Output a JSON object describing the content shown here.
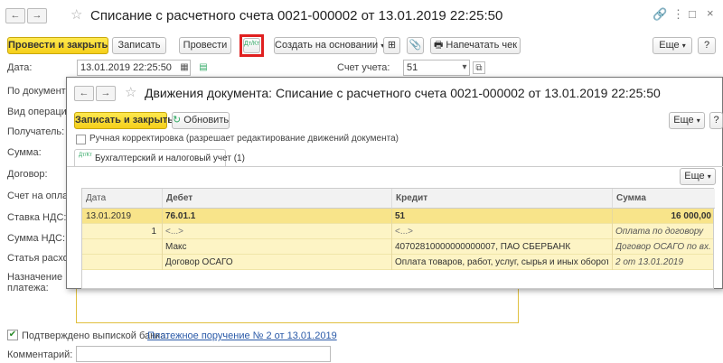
{
  "doc": {
    "title": "Списание с расчетного счета 0021-000002 от 13.01.2019 22:25:50",
    "nav_back": "←",
    "nav_forward": "→",
    "toolbar": {
      "post_close": "Провести и закрыть",
      "save": "Записать",
      "post": "Провести",
      "dtkt_icon": "Дт/Кт",
      "create_based": "Создать на основании",
      "print_check": "Напечатать чек",
      "more": "Еще",
      "help": "?"
    },
    "labels": {
      "date": "Дата:",
      "by_document": "По документу №",
      "operation": "Вид операции:",
      "recipient": "Получатель:",
      "sum": "Сумма:",
      "contract": "Договор:",
      "pay_account": "Счет на оплату",
      "vat_rate": "Ставка НДС:",
      "vat_sum": "Сумма НДС:",
      "expense_item": "Статья расходов",
      "purpose_1": "Назначение",
      "purpose_2": "платежа:",
      "account": "Счет учета:",
      "confirmed": "Подтверждено выпиской банка:",
      "comment": "Комментарий:"
    },
    "date_value": "13.01.2019 22:25:50",
    "account_value": "51",
    "payment_link": "Платежное поручение № 2 от 13.01.2019",
    "comment_value": ""
  },
  "movements": {
    "title": "Движения документа: Списание с расчетного счета 0021-000002 от 13.01.2019 22:25:50",
    "save_close": "Записать и закрыть",
    "refresh": "Обновить",
    "more": "Еще",
    "help": "?",
    "manual_adjust": "Ручная корректировка (разрешает редактирование движений документа)",
    "tab": "Бухгалтерский и налоговый учет (1)",
    "tab_icon": "Дт/Кт",
    "table_more": "Еще",
    "columns": {
      "date": "Дата",
      "debit": "Дебет",
      "credit": "Кредит",
      "sum": "Сумма"
    },
    "rows": [
      {
        "date": "13.01.2019",
        "debit": "76.01.1",
        "credit": "51",
        "sum": "16 000,00"
      },
      {
        "num": "1",
        "debit": "<...>",
        "credit": "<...>",
        "sum": "Оплата по договору"
      },
      {
        "debit": "Макс",
        "credit": "40702810000000000007, ПАО СБЕРБАНК",
        "sum": "Договор ОСАГО по вх.д."
      },
      {
        "debit": "Договор ОСАГО",
        "credit": "Оплата товаров, работ, услуг, сырья и иных оборотных а...",
        "sum": "2 от 13.01.2019"
      }
    ]
  }
}
